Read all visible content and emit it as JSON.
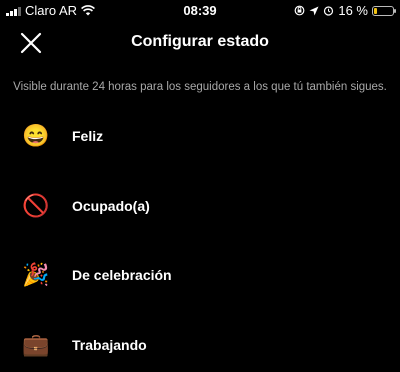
{
  "status_bar": {
    "carrier": "Claro AR",
    "time": "08:39",
    "battery_percent_text": "16 %",
    "battery_level": 0.16
  },
  "header": {
    "title": "Configurar estado"
  },
  "subtitle": "Visible durante 24 horas para los seguidores a los que tú también sigues.",
  "statuses": [
    {
      "emoji": "😄",
      "label": "Feliz"
    },
    {
      "emoji": "🚫",
      "label": "Ocupado(a)"
    },
    {
      "emoji": "🎉",
      "label": "De celebración"
    },
    {
      "emoji": "💼",
      "label": "Trabajando"
    }
  ],
  "colors": {
    "background": "#000000",
    "text": "#ffffff",
    "subtitle": "#a8a8a8",
    "battery": "#f2c413"
  }
}
